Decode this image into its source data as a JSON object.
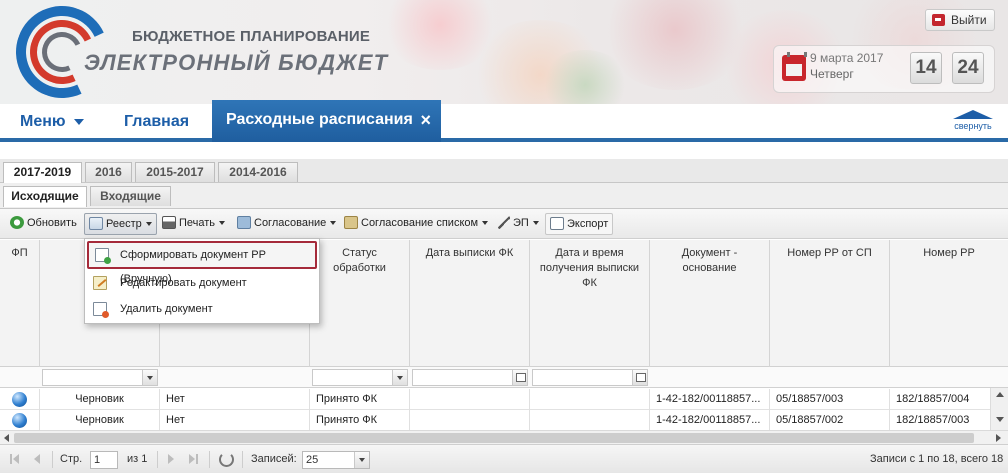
{
  "header": {
    "brand_top": "БЮДЖЕТНОЕ ПЛАНИРОВАНИЕ",
    "brand_main": "ЭЛЕКТРОННЫЙ БЮДЖЕТ",
    "logout_label": "Выйти",
    "date": "9 марта 2017",
    "weekday": "Четверг",
    "hours": "14",
    "minutes": "24"
  },
  "nav": {
    "menu_label": "Меню",
    "home_label": "Главная",
    "active_tab": "Расходные расписания",
    "close_glyph": "×",
    "collapse_label": "свернуть"
  },
  "year_tabs": [
    "2017-2019",
    "2016",
    "2015-2017",
    "2014-2016"
  ],
  "doc_tabs": [
    "Исходящие",
    "Входящие"
  ],
  "toolbar": {
    "refresh": "Обновить",
    "registry": "Реестр",
    "print": "Печать",
    "approval": "Согласование",
    "approval_list": "Согласование списком",
    "ep": "ЭП",
    "export": "Экспорт"
  },
  "dropdown": {
    "items": [
      "Сформировать документ РР (Вручную)",
      "Редактировать документ",
      "Удалить документ"
    ]
  },
  "columns": [
    "ФП",
    "",
    "",
    "Статус обработки",
    "Дата выписки ФК",
    "Дата и время получения выписки ФК",
    "Документ - основание",
    "Номер РР от СП",
    "Номер РР"
  ],
  "rows": [
    {
      "status": "Черновик",
      "flag": "Нет",
      "processing": "Принято ФК",
      "extract_date": "",
      "received": "",
      "basis": "1-42-182/00118857...",
      "rr_sp": "05/18857/003",
      "rr": "182/18857/004"
    },
    {
      "status": "Черновик",
      "flag": "Нет",
      "processing": "Принято ФК",
      "extract_date": "",
      "received": "",
      "basis": "1-42-182/00118857...",
      "rr_sp": "05/18857/002",
      "rr": "182/18857/003"
    }
  ],
  "pager": {
    "page_label": "Стр.",
    "page_value": "1",
    "of_label": "из 1",
    "records_label": "Записей:",
    "records_value": "25",
    "summary": "Записи с 1 по 18, всего 18"
  },
  "colors": {
    "accent": "#2a6aa7",
    "highlight_border": "#a52a3a",
    "logo_blue": "#1e6db8",
    "logo_red": "#d33a2c"
  }
}
